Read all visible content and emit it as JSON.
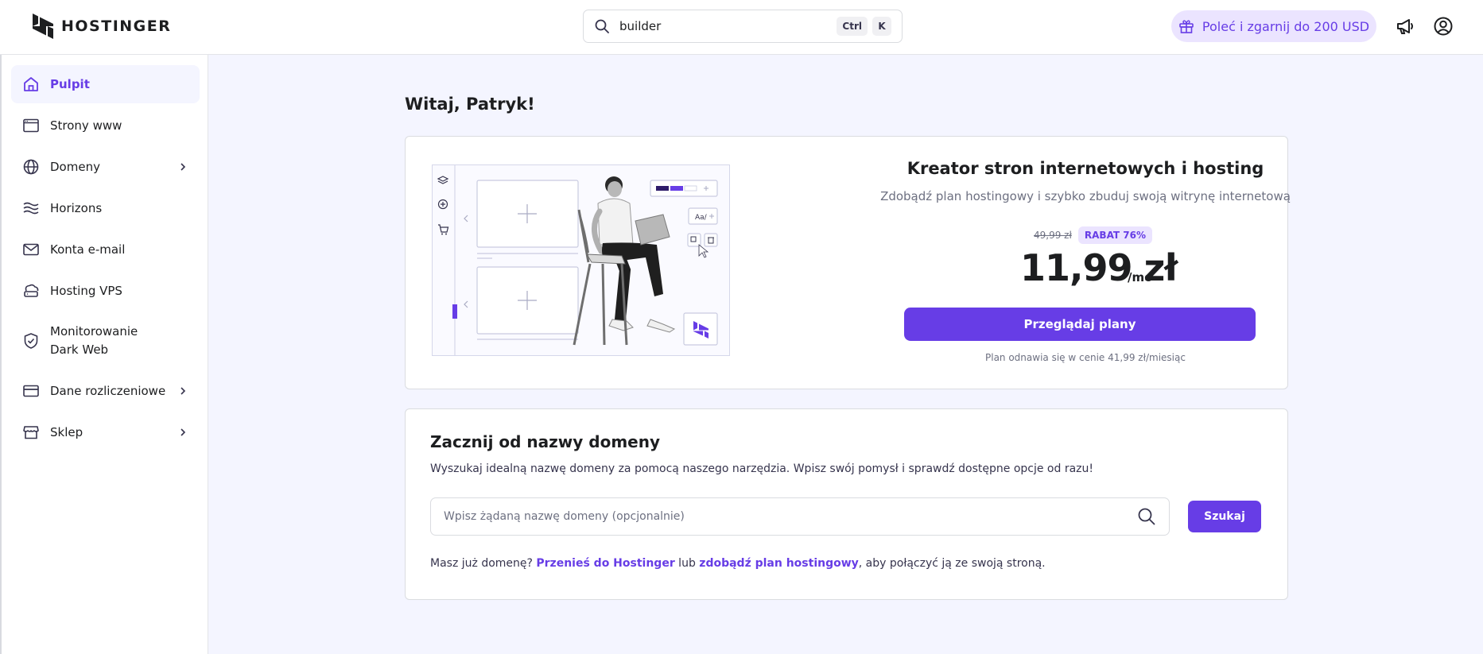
{
  "colors": {
    "accent": "#673de6",
    "accent_light": "#ebe4ff",
    "bg": "#f4f5ff"
  },
  "header": {
    "logo_text": "HOSTINGER",
    "search_value": "builder",
    "shortcut_keys": [
      "Ctrl",
      "K"
    ],
    "referral_label": "Poleć i zgarnij do 200 USD",
    "icons": [
      "gift-icon",
      "megaphone-icon",
      "account-icon"
    ]
  },
  "sidebar": {
    "items": [
      {
        "label": "Pulpit",
        "icon": "home-icon",
        "active": true
      },
      {
        "label": "Strony www",
        "icon": "browser-window-icon"
      },
      {
        "label": "Domeny",
        "icon": "globe-icon",
        "chevron": true
      },
      {
        "label": "Horizons",
        "icon": "waves-icon"
      },
      {
        "label": "Konta e-mail",
        "icon": "mail-icon"
      },
      {
        "label": "Hosting VPS",
        "icon": "cloud-server-icon"
      },
      {
        "label": "Monitorowanie Dark Web",
        "icon": "shield-check-icon"
      },
      {
        "label": "Dane rozliczeniowe",
        "icon": "credit-card-icon",
        "chevron": true
      },
      {
        "label": "Sklep",
        "icon": "store-icon",
        "chevron": true
      }
    ]
  },
  "main": {
    "welcome": "Witaj, Patryk!",
    "promo": {
      "title": "Kreator stron internetowych i hosting",
      "subtitle": "Zdobądź plan hostingowy i szybko zbuduj swoją witrynę internetową",
      "old_price": "49,99 zł",
      "discount": "RABAT 76%",
      "price": "11,99 zł",
      "per": "/mo",
      "cta": "Przeglądaj plany",
      "renewal": "Plan odnawia się w cenie 41,99 zł/miesiąc",
      "illustration_text": "Aa/"
    },
    "domain": {
      "title": "Zacznij od nazwy domeny",
      "description": "Wyszukaj idealną nazwę domeny za pomocą naszego narzędzia. Wpisz swój pomysł i sprawdź dostępne opcje od razu!",
      "placeholder": "Wpisz żądaną nazwę domeny (opcjonalnie)",
      "button": "Szukaj",
      "footer_prefix": "Masz już domenę? ",
      "link_transfer": "Przenieś do Hostinger",
      "footer_mid": " lub ",
      "link_plan": "zdobądź plan hostingowy",
      "footer_suffix": ", aby połączyć ją ze swoją stroną."
    }
  }
}
